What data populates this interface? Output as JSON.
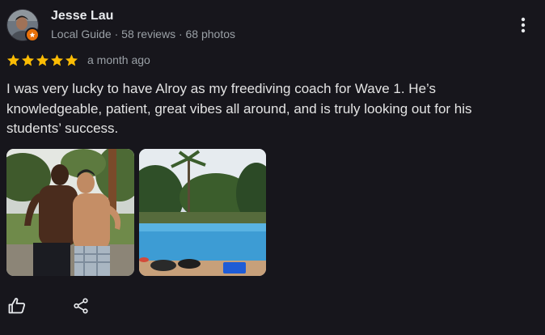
{
  "reviewer": {
    "name": "Jesse Lau",
    "meta": "Local Guide · 58 reviews · 68 photos",
    "badge_icon": "star-badge-icon",
    "badge_color": "#e8710a"
  },
  "review": {
    "rating": 5,
    "max_rating": 5,
    "date": "a month ago",
    "text": "I was very lucky to have Alroy as my freediving coach for Wave 1. He’s knowledgeable, patient, great vibes all around, and is truly looking out for his students’ success."
  },
  "photos": [
    {
      "subject": "two-men-portrait"
    },
    {
      "subject": "swimming-pool"
    }
  ],
  "actions": {
    "like_icon": "thumbs-up-icon",
    "share_icon": "share-icon",
    "more_icon": "more-vert-icon"
  },
  "colors": {
    "background": "#17161c",
    "star": "#fbbc04",
    "text": "#e3e3e3",
    "muted": "#9aa0a6"
  }
}
